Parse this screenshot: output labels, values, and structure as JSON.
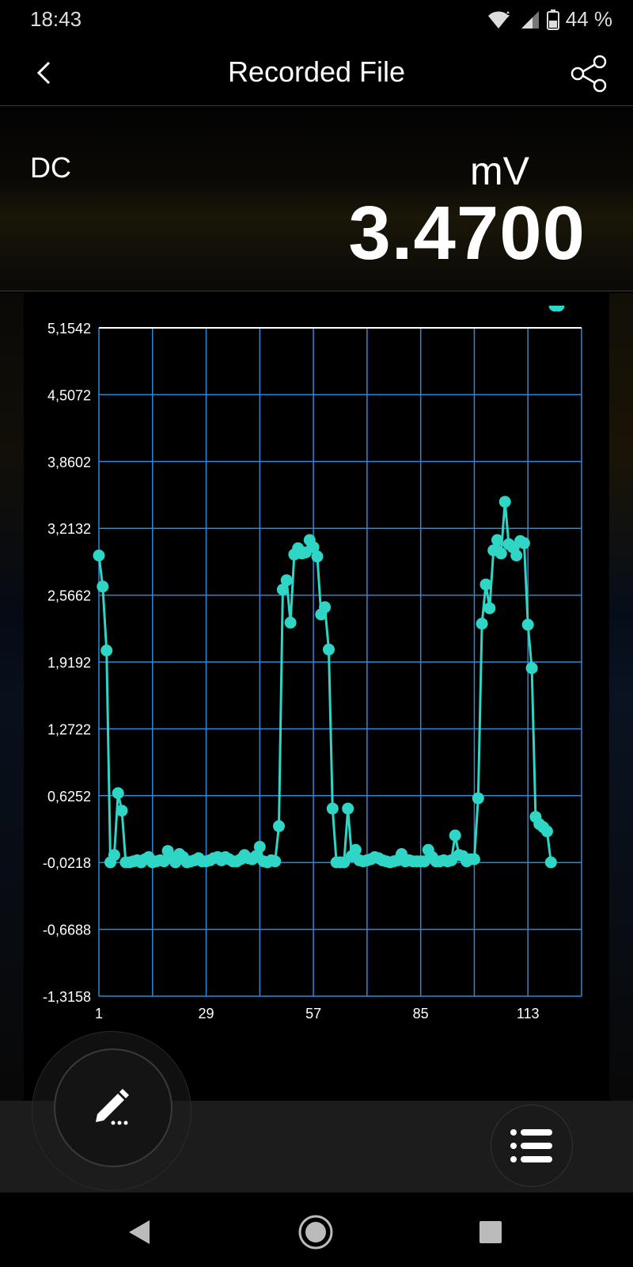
{
  "status": {
    "time": "18:43",
    "battery": "44 %",
    "icons": [
      "wifi-icon",
      "signal-icon",
      "battery-icon"
    ]
  },
  "app_bar": {
    "title": "Recorded File",
    "back_icon": "chevron-left-icon",
    "share_icon": "share-icon"
  },
  "reading": {
    "mode": "DC",
    "unit": "mV",
    "value": "3.4700"
  },
  "colors": {
    "series": "#2fd6c6",
    "grid": "#2f88d6",
    "axis_text": "#ffffff",
    "bar_bg": "#1c1c1c"
  },
  "chart_data": {
    "type": "line",
    "ytick_labels": [
      "5,1542",
      "4,5072",
      "3,8602",
      "3,2132",
      "2,5662",
      "1,9192",
      "1,2722",
      "0,6252",
      "-0,0218",
      "-0,6688",
      "-1,3158"
    ],
    "xtick_labels": [
      "1",
      "29",
      "57",
      "85",
      "113"
    ],
    "xtick_values": [
      1,
      29,
      57,
      85,
      113
    ],
    "xlim": [
      1,
      127
    ],
    "ylim": [
      -1.3158,
      5.1542
    ],
    "grid": true,
    "marker": "circle",
    "x": [
      1,
      2,
      3,
      4,
      5,
      6,
      7,
      8,
      9,
      10,
      11,
      12,
      13,
      14,
      15,
      16,
      17,
      18,
      19,
      20,
      21,
      22,
      23,
      24,
      25,
      26,
      27,
      28,
      29,
      30,
      31,
      32,
      33,
      34,
      35,
      36,
      37,
      38,
      39,
      40,
      41,
      42,
      43,
      44,
      45,
      46,
      47,
      48,
      49,
      50,
      51,
      52,
      53,
      54,
      55,
      56,
      57,
      58,
      59,
      60,
      61,
      62,
      63,
      64,
      65,
      66,
      67,
      68,
      69,
      70,
      71,
      72,
      73,
      74,
      75,
      76,
      77,
      78,
      79,
      80,
      81,
      82,
      83,
      84,
      85,
      86,
      87,
      88,
      89,
      90,
      91,
      92,
      93,
      94,
      95,
      96,
      97,
      98,
      99,
      100,
      101,
      102,
      103,
      104,
      105,
      106,
      107,
      108,
      109,
      110,
      111,
      112,
      113,
      114,
      115,
      116,
      117,
      118,
      119,
      120,
      121
    ],
    "values": [
      2.95,
      2.65,
      2.03,
      -0.02,
      0.05,
      0.65,
      0.48,
      -0.02,
      -0.02,
      -0.01,
      0.0,
      -0.02,
      0.01,
      0.03,
      -0.02,
      -0.01,
      0.0,
      -0.01,
      0.09,
      0.02,
      -0.02,
      0.06,
      0.03,
      -0.02,
      -0.01,
      0.0,
      0.02,
      -0.01,
      -0.01,
      0.0,
      0.02,
      0.03,
      0.0,
      0.03,
      0.01,
      -0.01,
      -0.01,
      0.01,
      0.05,
      0.02,
      0.01,
      0.04,
      0.13,
      -0.01,
      -0.02,
      0.0,
      -0.01,
      0.33,
      2.62,
      2.71,
      2.3,
      2.96,
      3.02,
      2.97,
      2.98,
      3.1,
      3.03,
      2.94,
      2.38,
      2.45,
      2.04,
      0.5,
      -0.02,
      -0.02,
      -0.02,
      0.5,
      0.04,
      0.1,
      0.0,
      -0.01,
      0.0,
      0.01,
      0.03,
      0.02,
      0.0,
      -0.01,
      -0.02,
      -0.01,
      0.0,
      0.06,
      -0.01,
      0.0,
      -0.01,
      -0.01,
      -0.01,
      -0.01,
      0.1,
      0.03,
      -0.01,
      -0.01,
      0.0,
      -0.01,
      0.0,
      0.24,
      0.05,
      0.04,
      -0.01,
      0.01,
      0.01,
      0.6,
      2.29,
      2.67,
      2.44,
      3.0,
      3.1,
      2.97,
      3.47,
      3.06,
      3.03,
      2.95,
      3.09,
      3.07,
      2.28,
      1.86,
      0.42,
      0.35,
      0.32,
      0.28,
      -0.02
    ]
  },
  "actions": {
    "edit_icon": "edit-pencil-icon",
    "list_icon": "list-icon"
  },
  "nav": {
    "back_icon": "nav-back-icon",
    "home_icon": "nav-home-icon",
    "recents_icon": "nav-recents-icon"
  }
}
